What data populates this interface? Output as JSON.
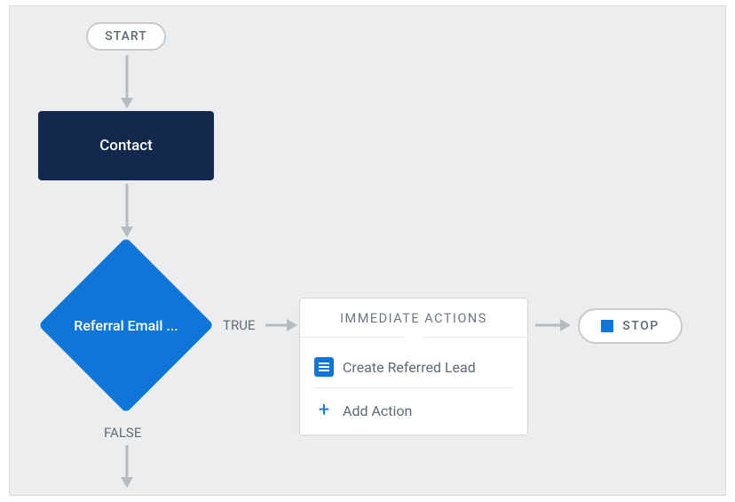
{
  "start": {
    "label": "START"
  },
  "object_node": {
    "label": "Contact"
  },
  "criteria": {
    "label": "Referral Email ..."
  },
  "branch_labels": {
    "true": "TRUE",
    "false": "FALSE"
  },
  "actions_panel": {
    "header": "IMMEDIATE ACTIONS",
    "action_1": "Create Referred Lead",
    "add_action": "Add Action"
  },
  "stop": {
    "label": "STOP"
  }
}
